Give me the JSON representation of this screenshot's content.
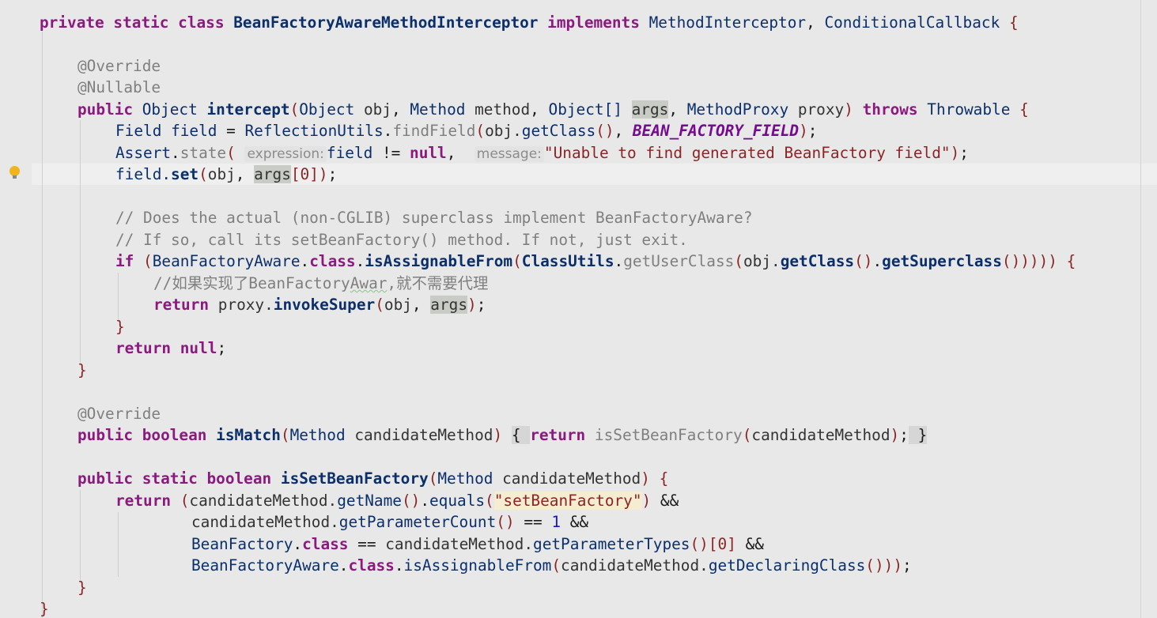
{
  "code": {
    "l1": {
      "kw1": "private",
      "kw2": "static",
      "kw3": "class",
      "cls": "BeanFactoryAwareMethodInterceptor",
      "kw4": "implements",
      "t1": "MethodInterceptor",
      "c": ",",
      "t2": "ConditionalCallback",
      "b": "{"
    },
    "l3": {
      "ann": "@Override"
    },
    "l4": {
      "ann": "@Nullable"
    },
    "l5": {
      "kw": "public",
      "t1": "Object",
      "fn": "intercept",
      "p1": "(",
      "t2": "Object",
      "v1": "obj",
      "c1": ",",
      "t3": "Method",
      "v2": "method",
      "c2": ",",
      "t4": "Object[]",
      "v3": "args",
      "c3": ",",
      "t5": "MethodProxy",
      "v4": "proxy",
      "p2": ")",
      "kw2": "throws",
      "t6": "Throwable",
      "b": "{"
    },
    "l6": {
      "t1": "Field",
      "v1": "field",
      "eq": "=",
      "t2": "ReflectionUtils",
      "dot": ".",
      "m": "findField",
      "p1": "(",
      "v2": "obj.",
      "m2": "getClass",
      "p2": "()",
      "c": ",",
      "k": "BEAN_FACTORY_FIELD",
      "p3": ")",
      "semi": ";"
    },
    "l7": {
      "t1": "Assert",
      "dot": ".",
      "m": "state",
      "p1": "(",
      "h1": "expression:",
      "v1": "field",
      "op": "!=",
      "kw": "null",
      "c": ",",
      "h2": "message:",
      "s": "\"Unable to find generated BeanFactory field\"",
      "p2": ")",
      "semi": ";"
    },
    "l8": {
      "v1": "field.",
      "m": "set",
      "p1": "(",
      "v2": "obj",
      "c": ",",
      "v3": "args",
      "br": "[0]",
      "p2": ")",
      "semi": ";"
    },
    "l10": {
      "cm": "// Does the actual (non-CGLIB) superclass implement BeanFactoryAware?"
    },
    "l11": {
      "cm": "// If so, call its setBeanFactory() method. If not, just exit."
    },
    "l12": {
      "kw": "if",
      "p1": "(",
      "t1": "BeanFactoryAware",
      "dot1": ".",
      "kw2": "class",
      "dot2": ".",
      "m1": "isAssignableFrom",
      "p2": "(",
      "t2": "ClassUtils",
      "dot3": ".",
      "m2": "getUserClass",
      "p3": "(",
      "v": "obj.",
      "m3": "getClass",
      "p4": "()",
      "dot4": ".",
      "m4": "getSuperclass",
      "p5": "()))))",
      "b": "{"
    },
    "l13": {
      "cm1": "//如果实现了BeanFactory",
      "cm2": "Awar",
      "cm3": ",就不需要代理"
    },
    "l14": {
      "kw": "return",
      "v1": "proxy.",
      "m": "invokeSuper",
      "p1": "(",
      "v2": "obj",
      "c": ",",
      "v3": "args",
      "p2": ")",
      "semi": ";"
    },
    "l15": {
      "b": "}"
    },
    "l16": {
      "kw": "return",
      "kw2": "null",
      "semi": ";"
    },
    "l17": {
      "b": "}"
    },
    "l19": {
      "ann": "@Override"
    },
    "l20": {
      "kw1": "public",
      "kw2": "boolean",
      "fn": "isMatch",
      "p1": "(",
      "t": "Method",
      "v": "candidateMethod",
      "p2": ")",
      "b1": "{",
      "kw3": "return",
      "m": "isSetBeanFactory",
      "p3": "(",
      "v2": "candidateMethod",
      "p4": ")",
      "semi": ";",
      "b2": "}"
    },
    "l22": {
      "kw1": "public",
      "kw2": "static",
      "kw3": "boolean",
      "fn": "isSetBeanFactory",
      "p1": "(",
      "t": "Method",
      "v": "candidateMethod",
      "p2": ")",
      "b": "{"
    },
    "l23": {
      "kw": "return",
      "p1": "(",
      "v": "candidateMethod.",
      "m1": "getName",
      "p2": "()",
      "dot": ".",
      "m2": "equals",
      "p3": "(",
      "s": "\"setBeanFactory\"",
      "p4": ")",
      "op": "&&"
    },
    "l24": {
      "v": "candidateMethod.",
      "m": "getParameterCount",
      "p": "()",
      "op": "==",
      "n": "1",
      "op2": "&&"
    },
    "l25": {
      "t": "BeanFactory",
      "dot": ".",
      "kw": "class",
      "op": "==",
      "v": "candidateMethod.",
      "m": "getParameterTypes",
      "p": "()",
      "br": "[0]",
      "op2": "&&"
    },
    "l26": {
      "t": "BeanFactoryAware",
      "dot": ".",
      "kw": "class",
      "dot2": ".",
      "m": "isAssignableFrom",
      "p1": "(",
      "v": "candidateMethod.",
      "m2": "getDeclaringClass",
      "p2": "()))",
      "semi": ";"
    },
    "l27": {
      "b": "}"
    },
    "l28": {
      "b": "}"
    }
  }
}
